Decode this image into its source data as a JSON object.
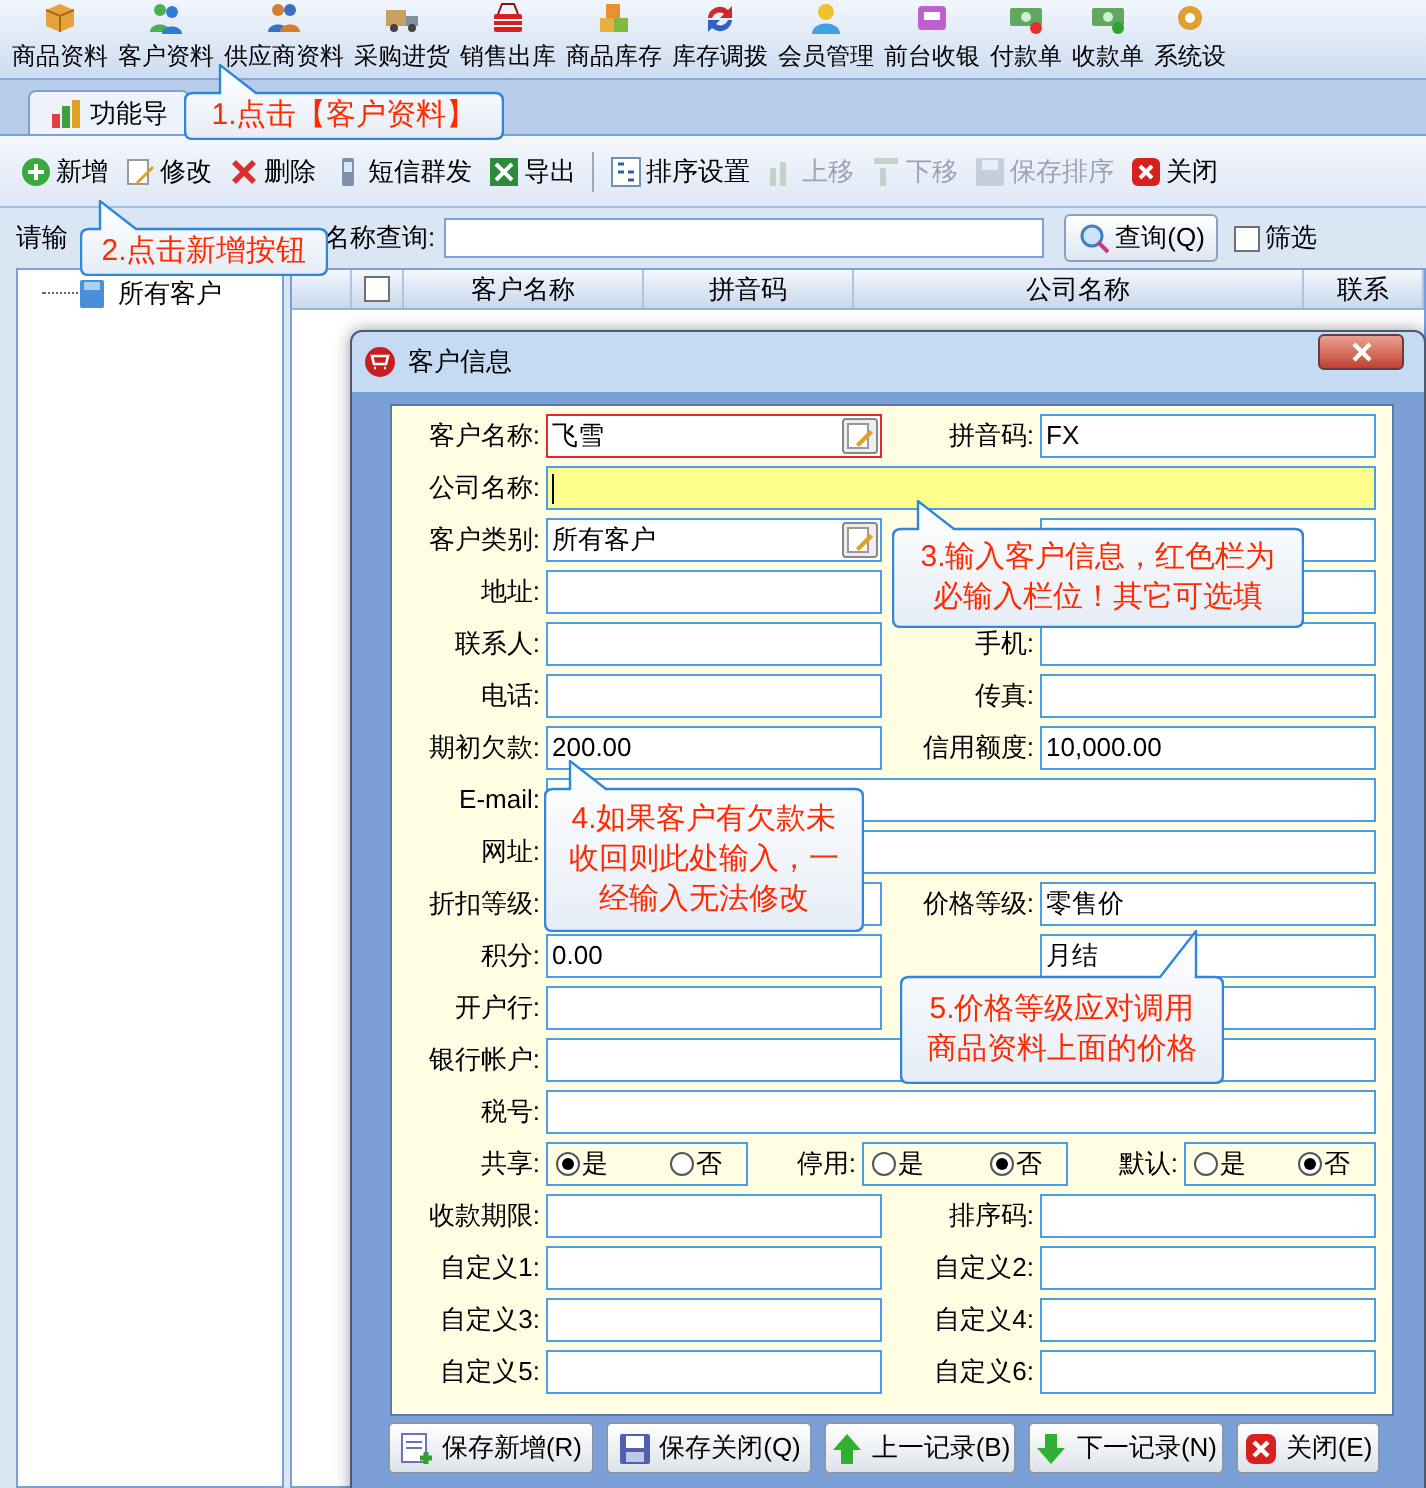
{
  "toolbar": [
    "商品资料",
    "客户资料",
    "供应商资料",
    "采购进货",
    "销售出库",
    "商品库存",
    "库存调拨",
    "会员管理",
    "前台收银",
    "付款单",
    "收款单",
    "系统设"
  ],
  "tabs": [
    {
      "label": "功能导",
      "selected": true
    }
  ],
  "actions": [
    {
      "label": "新增",
      "disabled": false
    },
    {
      "label": "修改",
      "disabled": false
    },
    {
      "label": "删除",
      "disabled": false
    },
    {
      "label": "短信群发",
      "disabled": false
    },
    {
      "label": "导出",
      "disabled": false
    },
    {
      "label": "排序设置",
      "disabled": false
    },
    {
      "label": "上移",
      "disabled": true
    },
    {
      "label": "下移",
      "disabled": true
    },
    {
      "label": "保存排序",
      "disabled": true
    },
    {
      "label": "关闭",
      "disabled": false
    }
  ],
  "search": {
    "label": "请输",
    "query_label": "名称查询:",
    "button": "查询(Q)",
    "filter": {
      "label": "筛选",
      "checked": false
    }
  },
  "tree": [
    {
      "label": "所有客户"
    }
  ],
  "grid": {
    "select_all": {
      "checked": false
    },
    "columns": [
      "客户名称",
      "拼音码",
      "公司名称",
      "联系"
    ]
  },
  "dialog": {
    "title": "客户信息",
    "rows": [
      {
        "kind": "pair",
        "fields": [
          {
            "label": "客户名称:",
            "value": "飞雪",
            "picker": true,
            "required": true,
            "focused": false
          },
          {
            "label": "拼音码:",
            "value": "FX",
            "picker": false,
            "required": false,
            "focused": false
          }
        ]
      },
      {
        "kind": "wide",
        "field": {
          "label": "公司名称:",
          "picker": false,
          "required": false,
          "focused": true
        }
      },
      {
        "kind": "pair",
        "fields": [
          {
            "label": "客户类别:",
            "value": "所有客户",
            "picker": true,
            "required": false,
            "focused": false
          },
          {
            "picker": false,
            "required": false,
            "focused": false
          }
        ]
      },
      {
        "kind": "pair",
        "fields": [
          {
            "label": "地址:",
            "picker": false,
            "required": false,
            "focused": false
          },
          {
            "picker": false,
            "required": false,
            "focused": false
          }
        ]
      },
      {
        "kind": "pair",
        "fields": [
          {
            "label": "联系人:",
            "picker": false,
            "required": false,
            "focused": false
          },
          {
            "label": "手机:",
            "picker": false,
            "required": false,
            "focused": false
          }
        ]
      },
      {
        "kind": "pair",
        "fields": [
          {
            "label": "电话:",
            "picker": false,
            "required": false,
            "focused": false
          },
          {
            "label": "传真:",
            "picker": false,
            "required": false,
            "focused": false
          }
        ]
      },
      {
        "kind": "pair",
        "fields": [
          {
            "label": "期初欠款:",
            "value": "200.00",
            "picker": false,
            "required": false,
            "focused": false
          },
          {
            "label": "信用额度:",
            "value": "10,000.00",
            "picker": false,
            "required": false,
            "focused": false
          }
        ]
      },
      {
        "kind": "wide",
        "field": {
          "label": "E-mail:",
          "picker": false,
          "required": false,
          "focused": false
        }
      },
      {
        "kind": "wide",
        "field": {
          "label": "网址:",
          "picker": false,
          "required": false,
          "focused": false
        }
      },
      {
        "kind": "pair",
        "fields": [
          {
            "label": "折扣等级:",
            "picker": false,
            "required": false,
            "focused": false
          },
          {
            "label": "价格等级:",
            "value": "零售价",
            "picker": false,
            "required": false,
            "focused": false
          }
        ]
      },
      {
        "kind": "pair",
        "fields": [
          {
            "label": "积分:",
            "value": "0.00",
            "picker": false,
            "required": false,
            "focused": false
          },
          {
            "value": "月结",
            "picker": false,
            "required": false,
            "focused": false
          }
        ]
      },
      {
        "kind": "pair",
        "fields": [
          {
            "label": "开户行:",
            "picker": false,
            "required": false,
            "focused": false
          },
          {
            "picker": false,
            "required": false,
            "focused": false
          }
        ]
      },
      {
        "kind": "wide",
        "field": {
          "label": "银行帐户:",
          "picker": false,
          "required": false,
          "focused": false
        }
      },
      {
        "kind": "wide",
        "field": {
          "label": "税号:",
          "picker": false,
          "required": false,
          "focused": false
        }
      },
      {
        "kind": "radios",
        "groups": [
          {
            "label": "共享:",
            "options": [
              {
                "label": "是",
                "selected": true
              },
              {
                "label": "否",
                "selected": false
              }
            ]
          },
          {
            "label": "停用:",
            "options": [
              {
                "label": "是",
                "selected": false
              },
              {
                "label": "否",
                "selected": true
              }
            ]
          },
          {
            "label": "默认:",
            "options": [
              {
                "label": "是",
                "selected": false
              },
              {
                "label": "否",
                "selected": true
              }
            ]
          }
        ]
      },
      {
        "kind": "pair",
        "fields": [
          {
            "label": "收款期限:",
            "picker": false,
            "required": false,
            "focused": false
          },
          {
            "label": "排序码:",
            "picker": false,
            "required": false,
            "focused": false
          }
        ]
      },
      {
        "kind": "pair",
        "fields": [
          {
            "label": "自定义1:",
            "picker": false,
            "required": false,
            "focused": false
          },
          {
            "label": "自定义2:",
            "picker": false,
            "required": false,
            "focused": false
          }
        ]
      },
      {
        "kind": "pair",
        "fields": [
          {
            "label": "自定义3:",
            "picker": false,
            "required": false,
            "focused": false
          },
          {
            "label": "自定义4:",
            "picker": false,
            "required": false,
            "focused": false
          }
        ]
      },
      {
        "kind": "pair",
        "fields": [
          {
            "label": "自定义5:",
            "picker": false,
            "required": false,
            "focused": false
          },
          {
            "label": "自定义6:",
            "picker": false,
            "required": false,
            "focused": false
          }
        ]
      }
    ],
    "buttons": [
      "保存新增(R)",
      "保存关闭(Q)",
      "上一记录(B)",
      "下一记录(N)",
      "关闭(E)"
    ]
  },
  "callouts": [
    {
      "lines": [
        "1.点击【客户资料】"
      ]
    },
    {
      "lines": [
        "2.点击新增按钮"
      ]
    },
    {
      "lines": [
        "3.输入客户信息，红色栏为",
        "必输入栏位！其它可选填"
      ]
    },
    {
      "lines": [
        "4.如果客户有欠款未",
        "收回则此处输入，一",
        "经输入无法修改"
      ]
    },
    {
      "lines": [
        "5.价格等级应对调用",
        "商品资料上面的价格"
      ]
    }
  ]
}
